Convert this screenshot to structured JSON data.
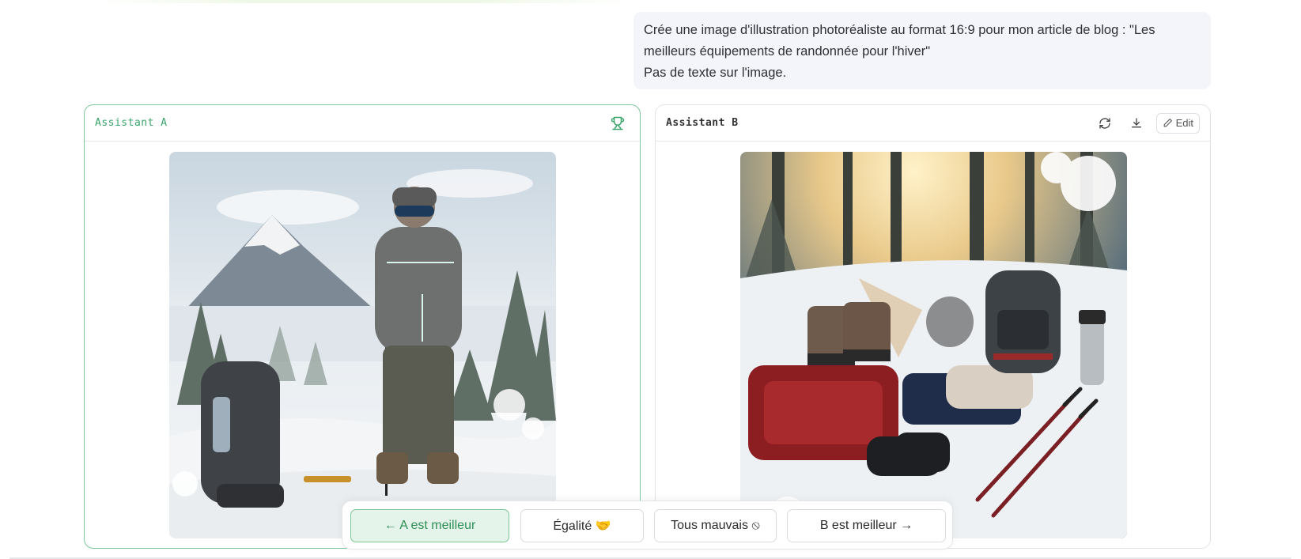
{
  "prompt": {
    "line1": "Crée une image d'illustration photoréaliste au format 16:9 pour mon article de blog : \"Les",
    "line2": "meilleurs équipements de randonnée pour l'hiver\"",
    "line3": "Pas de texte sur l'image."
  },
  "panel_a": {
    "title": "Assistant A",
    "icon": "trophy-icon",
    "image_alt": "Winter hiker with backpack and trekking pole in snowy mountain landscape"
  },
  "panel_b": {
    "title": "Assistant B",
    "actions": {
      "refresh_icon": "refresh-icon",
      "download_icon": "download-icon",
      "edit_label": "Edit"
    },
    "image_alt": "Winter hiking gear laid out on snow in a sunlit forest"
  },
  "vote": {
    "a_better": "← A est meilleur",
    "tie": "Égalité 🤝",
    "all_bad": "Tous mauvais ⦸",
    "b_better": "B est meilleur →"
  },
  "colors": {
    "accent_green": "#3aa46b",
    "prompt_bg": "#f3f5fb"
  }
}
